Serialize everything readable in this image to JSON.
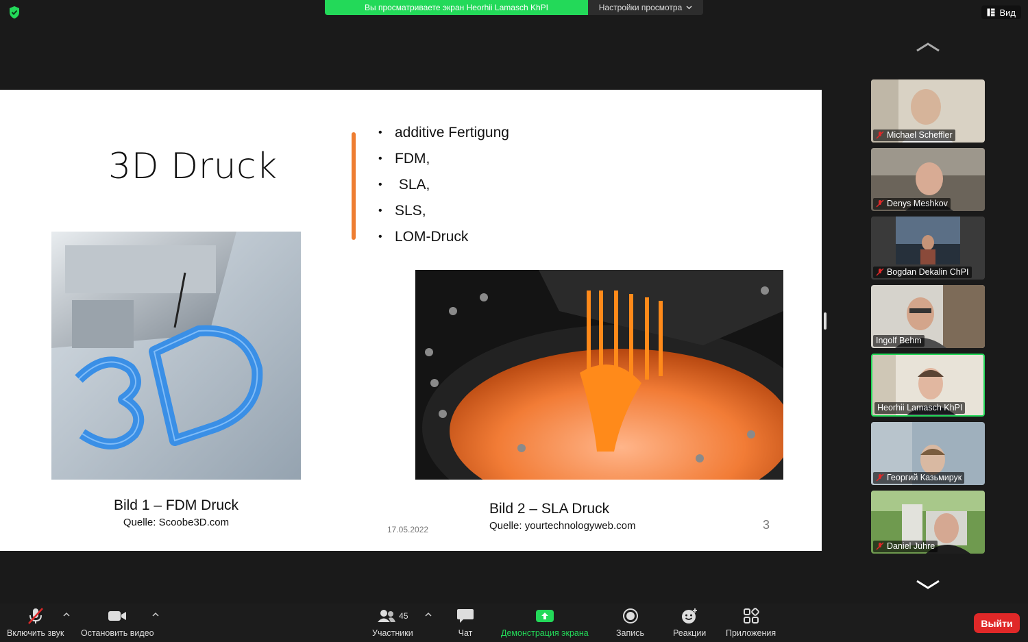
{
  "top": {
    "share_banner": "Вы просматриваете экран Heorhii Lamasch KhPI",
    "view_options": "Настройки просмотра",
    "view_button": "Вид"
  },
  "slide": {
    "title": "3D Druck",
    "bullets": [
      "additive Fertigung",
      "FDM,",
      " SLA,",
      "SLS,",
      "LOM-Druck"
    ],
    "caption1": {
      "title": "Bild 1 – FDM Druck",
      "source": "Quelle: Scoobe3D.com"
    },
    "caption2": {
      "title": "Bild 2 – SLA Druck",
      "source": "Quelle: yourtechnologyweb.com"
    },
    "date": "17.05.2022",
    "page": "3",
    "accent_color": "#ee7d31"
  },
  "participants": [
    {
      "name": "Michael Scheffler",
      "muted": true
    },
    {
      "name": "Denys Meshkov",
      "muted": true
    },
    {
      "name": "Bogdan Dekalin ChPI",
      "muted": true
    },
    {
      "name": "Ingolf Behm",
      "muted": false
    },
    {
      "name": "Heorhii Lamasch KhPI",
      "muted": false,
      "active_speaker": true
    },
    {
      "name": "Георгий Казьмирук",
      "muted": true
    },
    {
      "name": "Daniel Juhre",
      "muted": true
    }
  ],
  "toolbar": {
    "unmute": "Включить звук",
    "stop_video": "Остановить видео",
    "participants": "Участники",
    "participants_count": "45",
    "chat": "Чат",
    "share_screen": "Демонстрация экрана",
    "record": "Запись",
    "reactions": "Реакции",
    "apps": "Приложения",
    "leave": "Выйти"
  },
  "colors": {
    "green": "#23d959",
    "leave_red": "#e02828"
  }
}
